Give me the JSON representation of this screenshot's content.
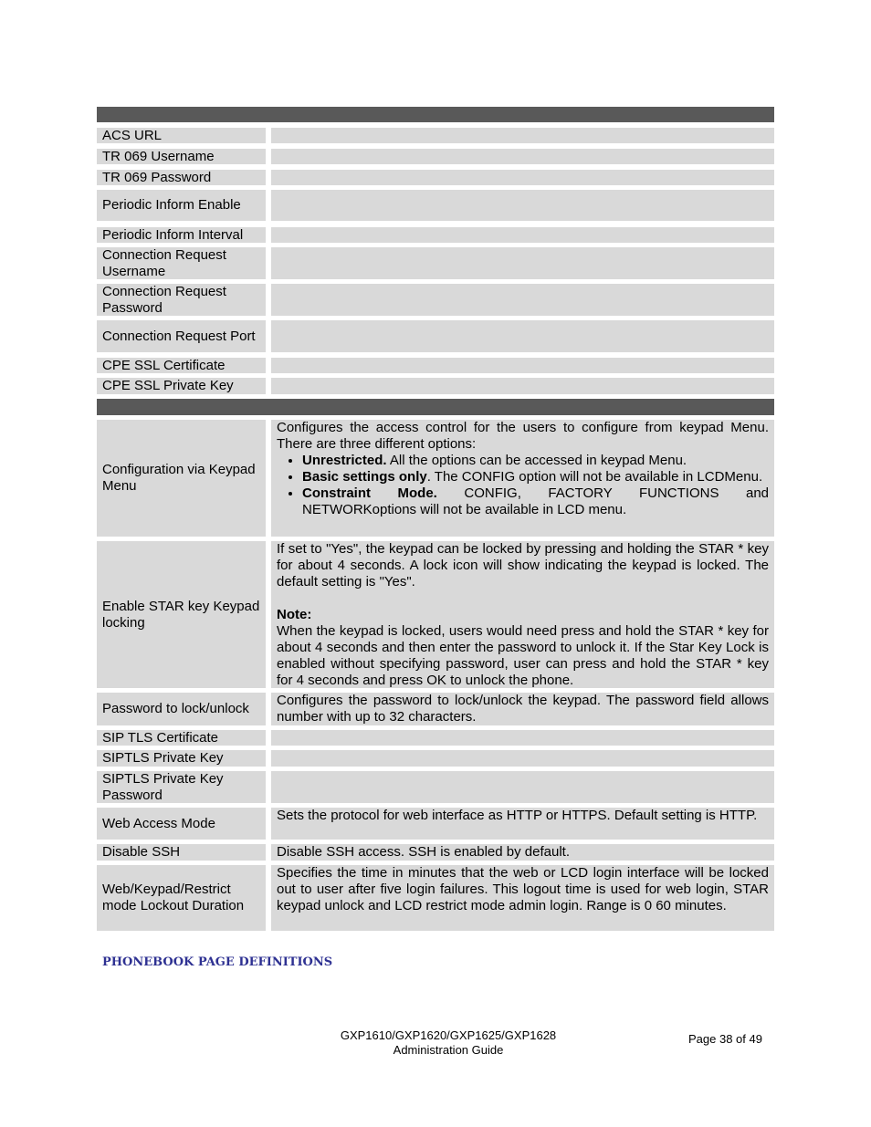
{
  "rows1": [
    "ACS URL",
    "TR 069 Username",
    "TR 069 Password",
    "Periodic Inform Enable",
    "Periodic Inform Interval",
    "Connection Request Username",
    "Connection Request Password",
    "Connection Request Port",
    "CPE SSL Certificate",
    "CPE SSL Private Key"
  ],
  "config_keypad": {
    "label": "Configuration via Keypad Menu",
    "intro": "Configures the access control for the users to configure from keypad Menu. There are three different options:",
    "b1_bold": "Unrestricted.",
    "b1": " All the options can be accessed in keypad Menu.",
    "b2_bold": "Basic settings only",
    "b2": ". The CONFIG option will not be available in LCDMenu.",
    "b3_bold": "Constraint Mode.",
    "b3": " CONFIG, FACTORY FUNCTIONS and NETWORKoptions will not be available in LCD menu."
  },
  "star": {
    "label": "Enable STAR key Keypad locking",
    "p1": "If set to \"Yes\", the keypad can be locked by pressing and holding the STAR * key for about 4 seconds. A lock icon will show indicating the keypad is locked. The default setting is \"Yes\".",
    "note": "Note:",
    "p2": "When the keypad is locked, users would need press and hold the STAR * key for about 4 seconds and then enter the password to unlock it. If the Star Key Lock is enabled without specifying password, user can press and hold the STAR * key for 4 seconds and press OK to unlock the phone."
  },
  "pwlock": {
    "label": "Password to lock/unlock",
    "desc": "Configures the password to lock/unlock the keypad. The password field allows number with up to 32 characters."
  },
  "sip_tls_cert": "SIP TLS Certificate",
  "siptls_key": "SIPTLS Private Key",
  "siptls_pw": "SIPTLS Private Key Password",
  "web": {
    "label": "Web Access Mode",
    "desc": "Sets the protocol for web interface as HTTP or HTTPS. Default setting is HTTP."
  },
  "ssh": {
    "label": "Disable SSH",
    "desc": "Disable SSH access. SSH is enabled by default."
  },
  "lockout": {
    "label": "Web/Keypad/Restrict mode Lockout Duration",
    "desc": "Specifies the time in minutes that the web or LCD login interface will be locked out to user after five login failures. This logout time is used for web login, STAR keypad unlock and LCD restrict mode admin login. Range is 0 60 minutes."
  },
  "section_heading": "PHONEBOOK PAGE DEFINITIONS",
  "footer": {
    "line1": "GXP1610/GXP1620/GXP1625/GXP1628",
    "line2": "Administration Guide",
    "page": "Page 38 of 49"
  }
}
